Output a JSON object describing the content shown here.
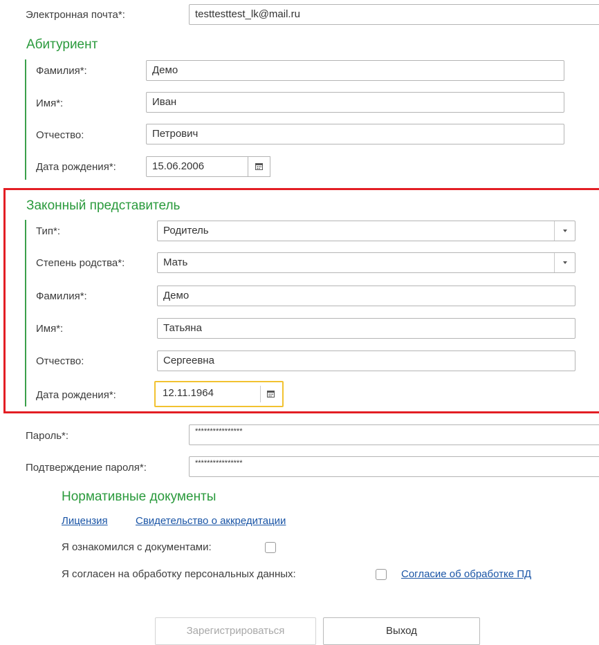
{
  "email": {
    "label": "Электронная почта*:",
    "value": "testtesttest_lk@mail.ru"
  },
  "applicant": {
    "title": "Абитуриент",
    "surname": {
      "label": "Фамилия*:",
      "value": "Демо"
    },
    "name": {
      "label": "Имя*:",
      "value": "Иван"
    },
    "patronymic": {
      "label": "Отчество:",
      "value": "Петрович"
    },
    "birth_date": {
      "label": "Дата рождения*:",
      "value": "15.06.2006"
    }
  },
  "representative": {
    "title": "Законный представитель",
    "type": {
      "label": "Тип*:",
      "value": "Родитель"
    },
    "relation": {
      "label": "Степень родства*:",
      "value": "Мать"
    },
    "surname": {
      "label": "Фамилия*:",
      "value": "Демо"
    },
    "name": {
      "label": "Имя*:",
      "value": "Татьяна"
    },
    "patronymic": {
      "label": "Отчество:",
      "value": "Сергеевна"
    },
    "birth_date": {
      "label": "Дата рождения*:",
      "value": "12.11.1964"
    }
  },
  "password": {
    "label": "Пароль*:",
    "value": "****************"
  },
  "password_confirm": {
    "label": "Подтверждение пароля*:",
    "value": "****************"
  },
  "documents": {
    "title": "Нормативные документы",
    "links": [
      "Лицензия",
      "Свидетельство о аккредитации"
    ],
    "ack_label": "Я ознакомился с документами:",
    "consent_label": "Я согласен на обработку персональных данных:",
    "consent_link": "Согласие об обработке ПД"
  },
  "buttons": {
    "register": "Зарегистрироваться",
    "exit": "Выход"
  },
  "colors": {
    "section_title": "#2a9a3c",
    "highlight_border": "#e31e24",
    "focus_border": "#f2c230",
    "link": "#1a55a6"
  },
  "icons": {
    "calendar": "calendar-icon",
    "dropdown": "chevron-down-icon"
  }
}
